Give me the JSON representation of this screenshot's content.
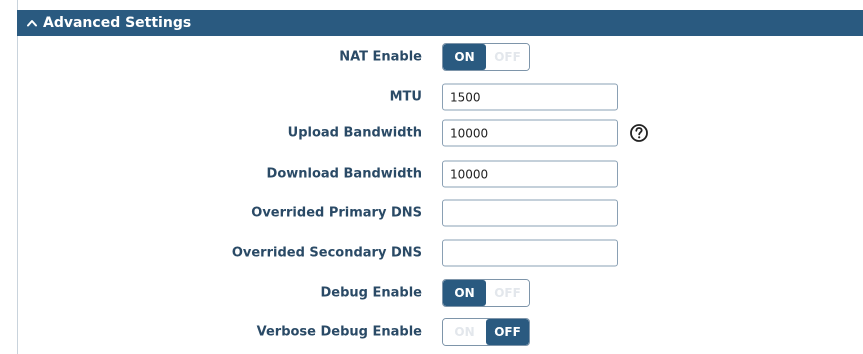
{
  "section": {
    "title": "Advanced Settings",
    "collapse_icon": "chevron-up-icon"
  },
  "nat": {
    "label": "NAT Enable",
    "on": "ON",
    "off": "OFF",
    "state": "on"
  },
  "mtu": {
    "label": "MTU",
    "value": "1500"
  },
  "upload": {
    "label": "Upload Bandwidth",
    "value": "10000",
    "help_icon": "help-circle-icon"
  },
  "download": {
    "label": "Download Bandwidth",
    "value": "10000"
  },
  "primary_dns": {
    "label": "Overrided Primary DNS",
    "value": ""
  },
  "secondary_dns": {
    "label": "Overrided Secondary DNS",
    "value": ""
  },
  "debug": {
    "label": "Debug Enable",
    "on": "ON",
    "off": "OFF",
    "state": "on"
  },
  "verbose": {
    "label": "Verbose Debug Enable",
    "on": "ON",
    "off": "OFF",
    "state": "off"
  },
  "colors": {
    "header_bg": "#2a5a80",
    "label_text": "#2a4a66",
    "toggle_active": "#2a5a80"
  }
}
